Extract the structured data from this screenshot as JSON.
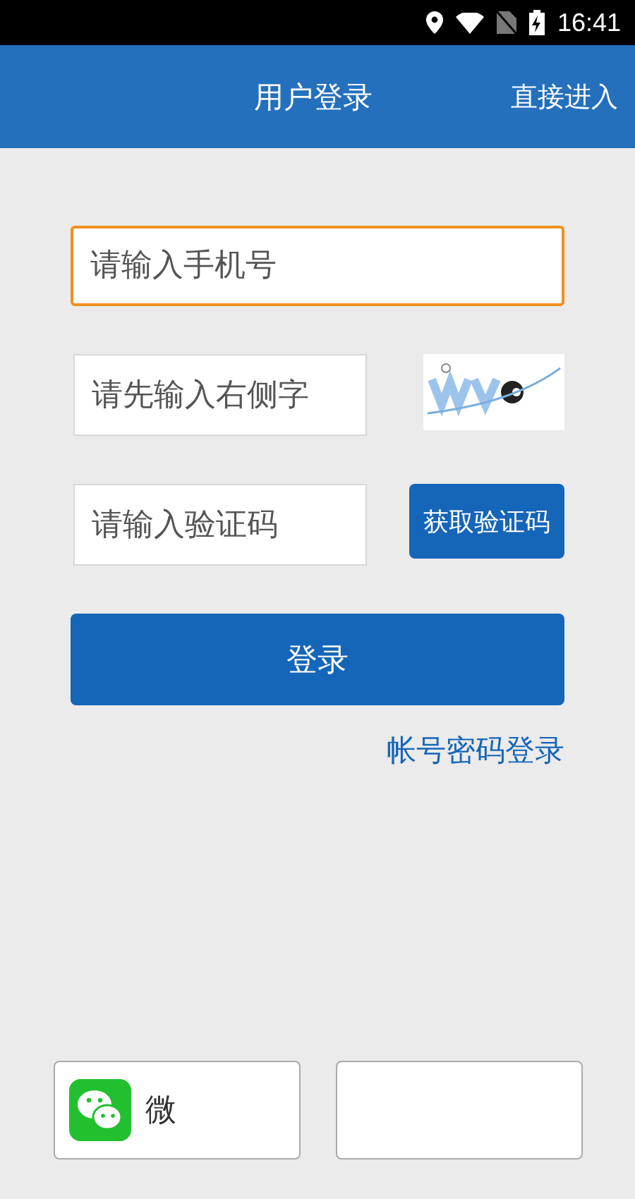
{
  "status_bar": {
    "time": "16:41"
  },
  "header": {
    "title": "用户登录",
    "action": "直接进入"
  },
  "phone_field": {
    "placeholder": "请输入手机号",
    "focused": true
  },
  "captcha_field": {
    "placeholder": "请先输入右侧字"
  },
  "code_field": {
    "placeholder": "请输入验证码"
  },
  "get_code_button": "获取验证码",
  "login_button": "登录",
  "password_login_link": "帐号密码登录",
  "social_buttons": [
    {
      "kind": "wechat",
      "label": "微"
    },
    {
      "kind": "other"
    }
  ]
}
